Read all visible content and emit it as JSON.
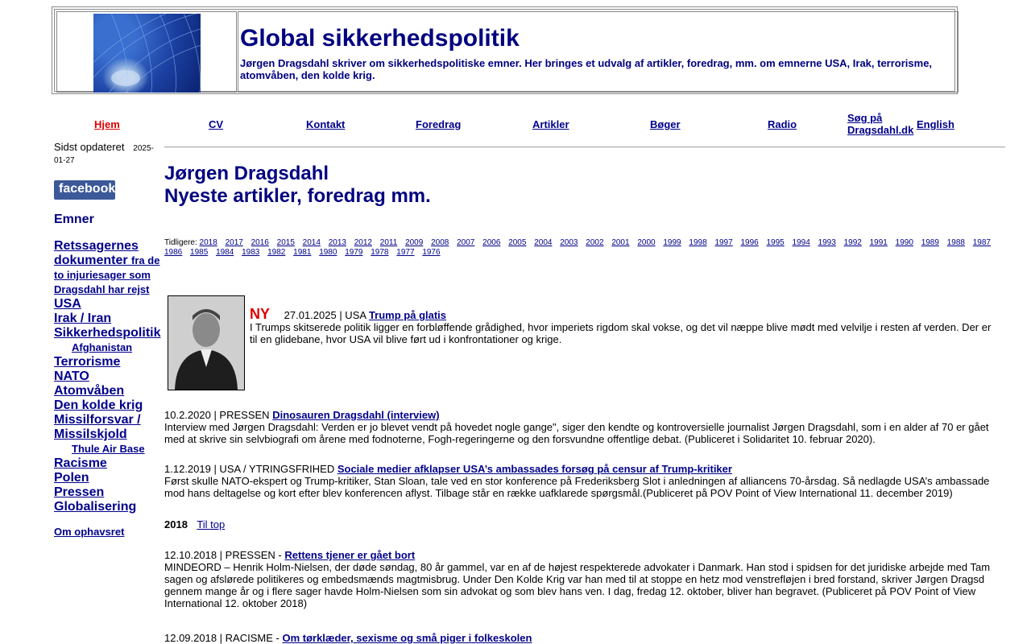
{
  "header": {
    "title": "Global sikkerhedspolitik",
    "subtitle": "Jørgen Dragsdahl skriver om sikkerhedspolitiske emner. Her bringes et udvalg af artikler, foredrag, mm. om emnerne USA, Irak, terrorisme, atomvåben, den kolde krig."
  },
  "nav": {
    "home": "Hjem",
    "cv": "CV",
    "kontakt": "Kontakt",
    "foredrag": "Foredrag",
    "artikler": "Artikler",
    "boger": "Bøger",
    "radio": "Radio",
    "search_line1": "Søg på",
    "search_line2": "Dragsdahl.dk",
    "english": "English"
  },
  "sidebar": {
    "updated_label": "Sidst opdateret",
    "updated_date": "2025-01-27",
    "facebook": "facebook",
    "topics_heading": "Emner",
    "topics": [
      "Retssagernes dokumenter",
      "fra de to injuriesager som Dragsdahl har rejst",
      "USA",
      "Irak / Iran",
      "Sikkerhedspolitik",
      "Afghanistan",
      "Terrorisme",
      "NATO",
      "Atomvåben",
      "Den kolde krig",
      "Missilforsvar / Missilskjold",
      "Thule Air Base",
      "Racisme",
      "Polen",
      "Pressen",
      "Globalisering"
    ],
    "copyright": "Om ophavsret"
  },
  "main": {
    "heading_line1": "Jørgen Dragsdahl",
    "heading_line2": "Nyeste artikler, foredrag mm.",
    "earlier_label": "Tidligere:",
    "years": [
      "2018",
      "2017",
      "2016",
      "2015",
      "2014",
      "2013",
      "2012",
      "2011",
      "2009",
      "2008",
      "2007",
      "2006",
      "2005",
      "2004",
      "2003",
      "2002",
      "2001",
      "2000",
      "1999",
      "1998",
      "1997",
      "1996",
      "1995",
      "1994",
      "1993",
      "1992",
      "1991",
      "1990",
      "1989",
      "1988",
      "1987",
      "1986",
      "1985",
      "1984",
      "1983",
      "1982",
      "1981",
      "1980",
      "1979",
      "1978",
      "1977",
      "1976"
    ],
    "featured": {
      "badge": "NY",
      "meta": "27.01.2025 | USA",
      "link": "Trump på glatis",
      "text_line1": "I Trumps skitserede politik ligger en forbløffende grådighed, hvor imperiets rigdom skal vokse, og det vil næppe blive mødt med velvilje i resten af verden. Der er",
      "text_line2": "til en glidebane, hvor USA vil blive ført ud i konfrontationer og krige."
    },
    "articles": [
      {
        "meta": "10.2.2020 | PRESSEN",
        "link": "Dinosauren Dragsdahl (interview)",
        "line1": "Interview med Jørgen Dragsdahl: Verden er jo blevet vendt på hovedet nogle gange\", siger den kendte og kontroversielle journalist Jørgen Dragsdahl, som i en alder af 70 er gået",
        "line2": "med at skrive sin selvbiografi om årene med fodnoterne, Fogh-regeringerne og den forsvundne offentlige debat. (Publiceret i Solidaritet 10. februar 2020).",
        "line3": "",
        "line4": ""
      },
      {
        "meta": "1.12.2019 | USA / YTRINGSFRIHED",
        "link": "Sociale medier afklapser USA’s ambassades forsøg på censur af Trump-kritiker",
        "line1": "Først skulle NATO-ekspert og Trump-kritiker, Stan Sloan, tale ved en stor konference på Frederiksberg Slot i anledningen af alliancens 70-årsdag. Så nedlagde USA’s ambassade",
        "line2": "mod hans deltagelse og kort efter blev konferencen aflyst. Tilbage står en række uafklarede spørgsmål.(Publiceret på POV Point of View International 11. december 2019)",
        "line3": "",
        "line4": ""
      },
      {
        "meta": "12.10.2018 | PRESSEN -",
        "link": "Rettens tjener er gået bort",
        "line1": "MINDEORD – Henrik Holm-Nielsen, der døde søndag, 80 år gammel, var en af de højest respekterede advokater i Danmark. Han stod i spidsen for det juridiske arbejde med Tam",
        "line2": "sagen  og afslørede politikeres og embedsmænds magtmisbrug. Under Den Kolde Krig var han med til at stoppe en hetz mod venstrefløjen i bred forstand, skriver Jørgen Dragsd",
        "line3": "gennem mange år og i flere sager havde Holm-Nielsen som sin advokat og som blev hans ven. I dag, fredag 12. oktober, bliver han begravet. (Publiceret på POV Point of View",
        "line4": "International 12. oktober 2018)"
      },
      {
        "meta": "12.09.2018 | RACISME -",
        "link": "Om tørklæder, sexisme og små piger i folkeskolen",
        "line1": "",
        "line2": "",
        "line3": "",
        "line4": ""
      }
    ],
    "year_header": "2018",
    "to_top": "Til top"
  }
}
